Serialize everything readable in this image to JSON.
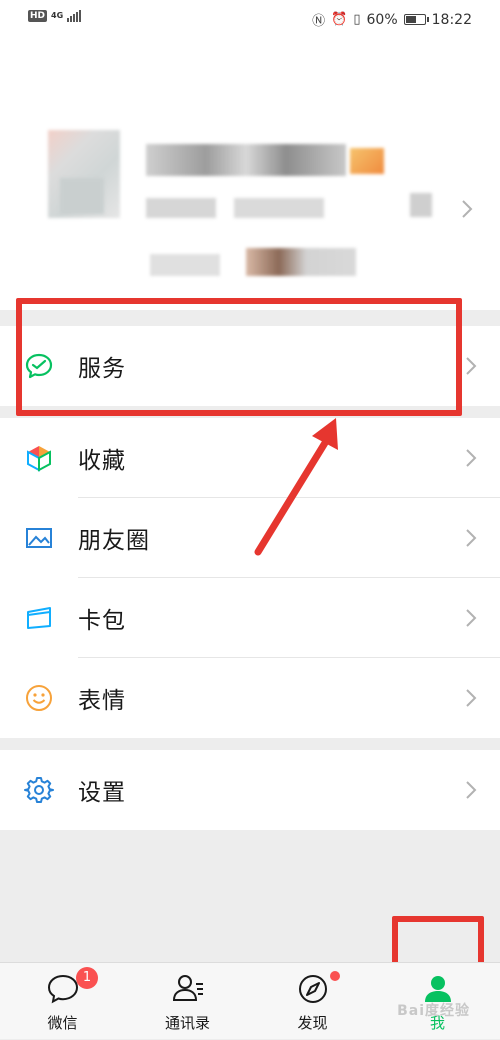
{
  "status_bar": {
    "network": "4G",
    "hd": "HD",
    "battery": "60%",
    "battery_level": 0.6,
    "time": "18:22"
  },
  "menu": {
    "services": {
      "label": "服务",
      "icon": "wechat-pay-icon"
    },
    "favorites": {
      "label": "收藏",
      "icon": "cube-icon"
    },
    "moments": {
      "label": "朋友圈",
      "icon": "image-icon"
    },
    "cards": {
      "label": "卡包",
      "icon": "card-icon"
    },
    "stickers": {
      "label": "表情",
      "icon": "smile-icon"
    },
    "settings": {
      "label": "设置",
      "icon": "gear-icon"
    }
  },
  "tabbar": {
    "chats": {
      "label": "微信",
      "badge": "1"
    },
    "contacts": {
      "label": "通讯录"
    },
    "discover": {
      "label": "发现"
    },
    "me": {
      "label": "我"
    }
  },
  "colors": {
    "accent_green": "#07c160",
    "badge_red": "#fa5151",
    "annotation_red": "#e6362f"
  },
  "watermark": "Bai度经验"
}
